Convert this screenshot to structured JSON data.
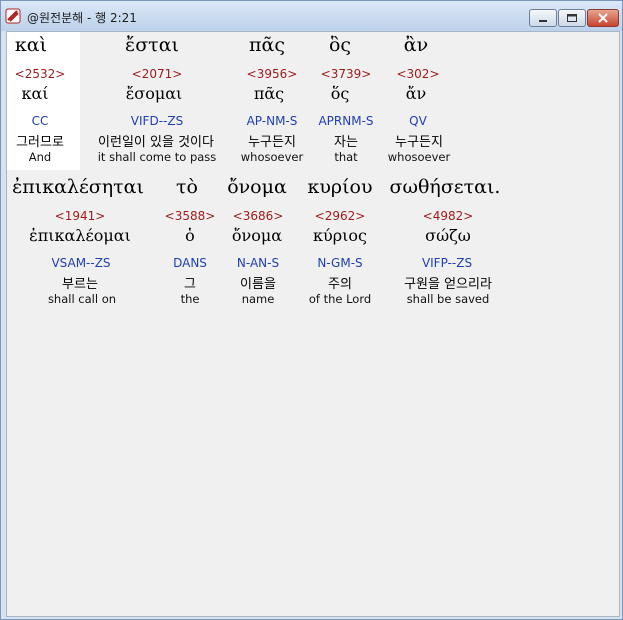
{
  "window": {
    "title": "@원전분해 - 행 2:21",
    "icon": "bible-app-icon"
  },
  "lines": [
    {
      "words": [
        {
          "greek": "καὶ",
          "strong": "<2532>",
          "lemma": "καί",
          "morph": "CC",
          "korean": "그러므로",
          "english": "And"
        },
        {
          "greek": "ἔσται",
          "strong": "<2071>",
          "lemma": "ἔσομαι",
          "morph": "VIFD--ZS",
          "korean": "이런일이 있을 것이다",
          "english": "it shall come to pass"
        },
        {
          "greek": "πᾶς",
          "strong": "<3956>",
          "lemma": "πᾶς",
          "morph": "AP-NM-S",
          "korean": "누구든지",
          "english": "whosoever"
        },
        {
          "greek": "ὃς",
          "strong": "<3739>",
          "lemma": "ὅς",
          "morph": "APRNM-S",
          "korean": "자는",
          "english": "that"
        },
        {
          "greek": "ἂν",
          "strong": "<302>",
          "lemma": "ἄν",
          "morph": "QV",
          "korean": "누구든지",
          "english": "whosoever"
        }
      ]
    },
    {
      "words": [
        {
          "greek": "ἐπικαλέσηται",
          "strong": "<1941>",
          "lemma": "ἐπικαλέομαι",
          "morph": "VSAM--ZS",
          "korean": "부르는",
          "english": "shall call on"
        },
        {
          "greek": "τὸ",
          "strong": "<3588>",
          "lemma": "ὁ",
          "morph": "DANS",
          "korean": "그",
          "english": "the"
        },
        {
          "greek": "ὄνομα",
          "strong": "<3686>",
          "lemma": "ὄνομα",
          "morph": "N-AN-S",
          "korean": "이름을",
          "english": "name"
        },
        {
          "greek": "κυρίου",
          "strong": "<2962>",
          "lemma": "κύριος",
          "morph": "N-GM-S",
          "korean": "주의",
          "english": "of the Lord"
        },
        {
          "greek": "σωθήσεται.",
          "strong": "<4982>",
          "lemma": "σώζω",
          "morph": "VIFP--ZS",
          "korean": "구원을 얻으리라",
          "english": "shall be saved"
        }
      ]
    }
  ]
}
